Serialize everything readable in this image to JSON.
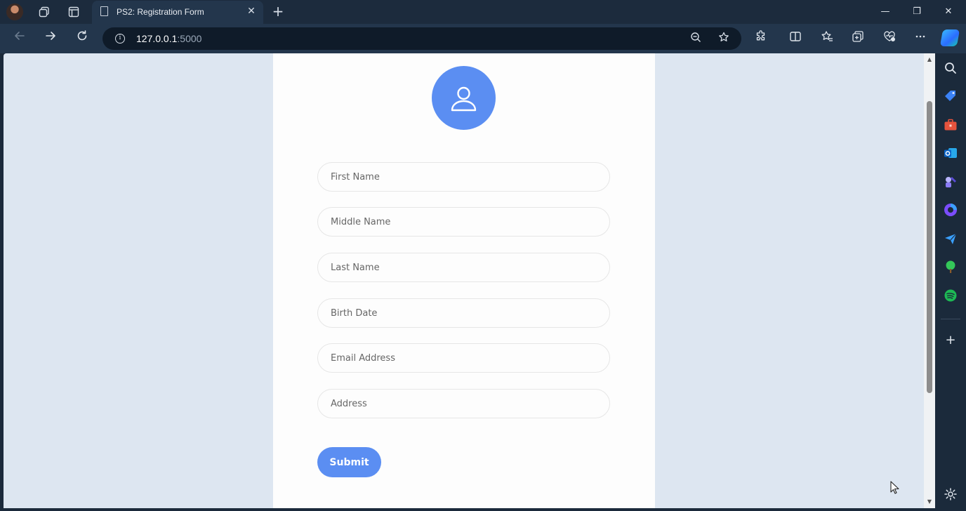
{
  "browser": {
    "tab_title": "PS2: Registration Form",
    "url_host": "127.0.0.1",
    "url_port": ":5000",
    "icons": {
      "profile": "profile-avatar",
      "workspaces": "workspaces-icon",
      "tab_actions": "tab-actions-icon",
      "tab_page": "page-icon",
      "tab_close": "close-icon",
      "new_tab": "plus-icon",
      "back": "back-arrow-icon",
      "forward": "forward-arrow-icon",
      "refresh": "refresh-icon",
      "site_info": "info-icon",
      "zoom": "zoom-out-icon",
      "favorite": "star-icon",
      "extensions": "puzzle-icon",
      "split_screen": "split-screen-icon",
      "favorites": "favorites-icon",
      "collections": "collections-icon",
      "browser_essentials": "heart-pulse-icon",
      "more": "more-icon",
      "copilot": "copilot-icon"
    },
    "window_controls": {
      "minimize": "—",
      "restore": "❐",
      "close": "✕"
    }
  },
  "form": {
    "placeholders": {
      "first_name": "First Name",
      "middle_name": "Middle Name",
      "last_name": "Last Name",
      "birth_date": "Birth Date",
      "email": "Email Address",
      "address": "Address"
    },
    "submit_label": "Submit",
    "accent_color": "#5b8ef2",
    "avatar_icon": "user-icon"
  },
  "sidebar": {
    "items": [
      {
        "name": "search-icon",
        "color": "#dfe5ec"
      },
      {
        "name": "shopping-tag-icon",
        "color": "#3b82f6"
      },
      {
        "name": "tools-briefcase-icon",
        "color": "#e5533d"
      },
      {
        "name": "outlook-icon",
        "color": "#1a73e8"
      },
      {
        "name": "games-icon",
        "color": "#8b7cf6"
      },
      {
        "name": "microsoft-365-icon",
        "color": "#7b4dff"
      },
      {
        "name": "send-icon",
        "color": "#3aa0ff"
      },
      {
        "name": "tree-icon",
        "color": "#34c759"
      },
      {
        "name": "spotify-icon",
        "color": "#1db954"
      }
    ],
    "add_label": "+",
    "settings_icon": "gear-icon"
  }
}
